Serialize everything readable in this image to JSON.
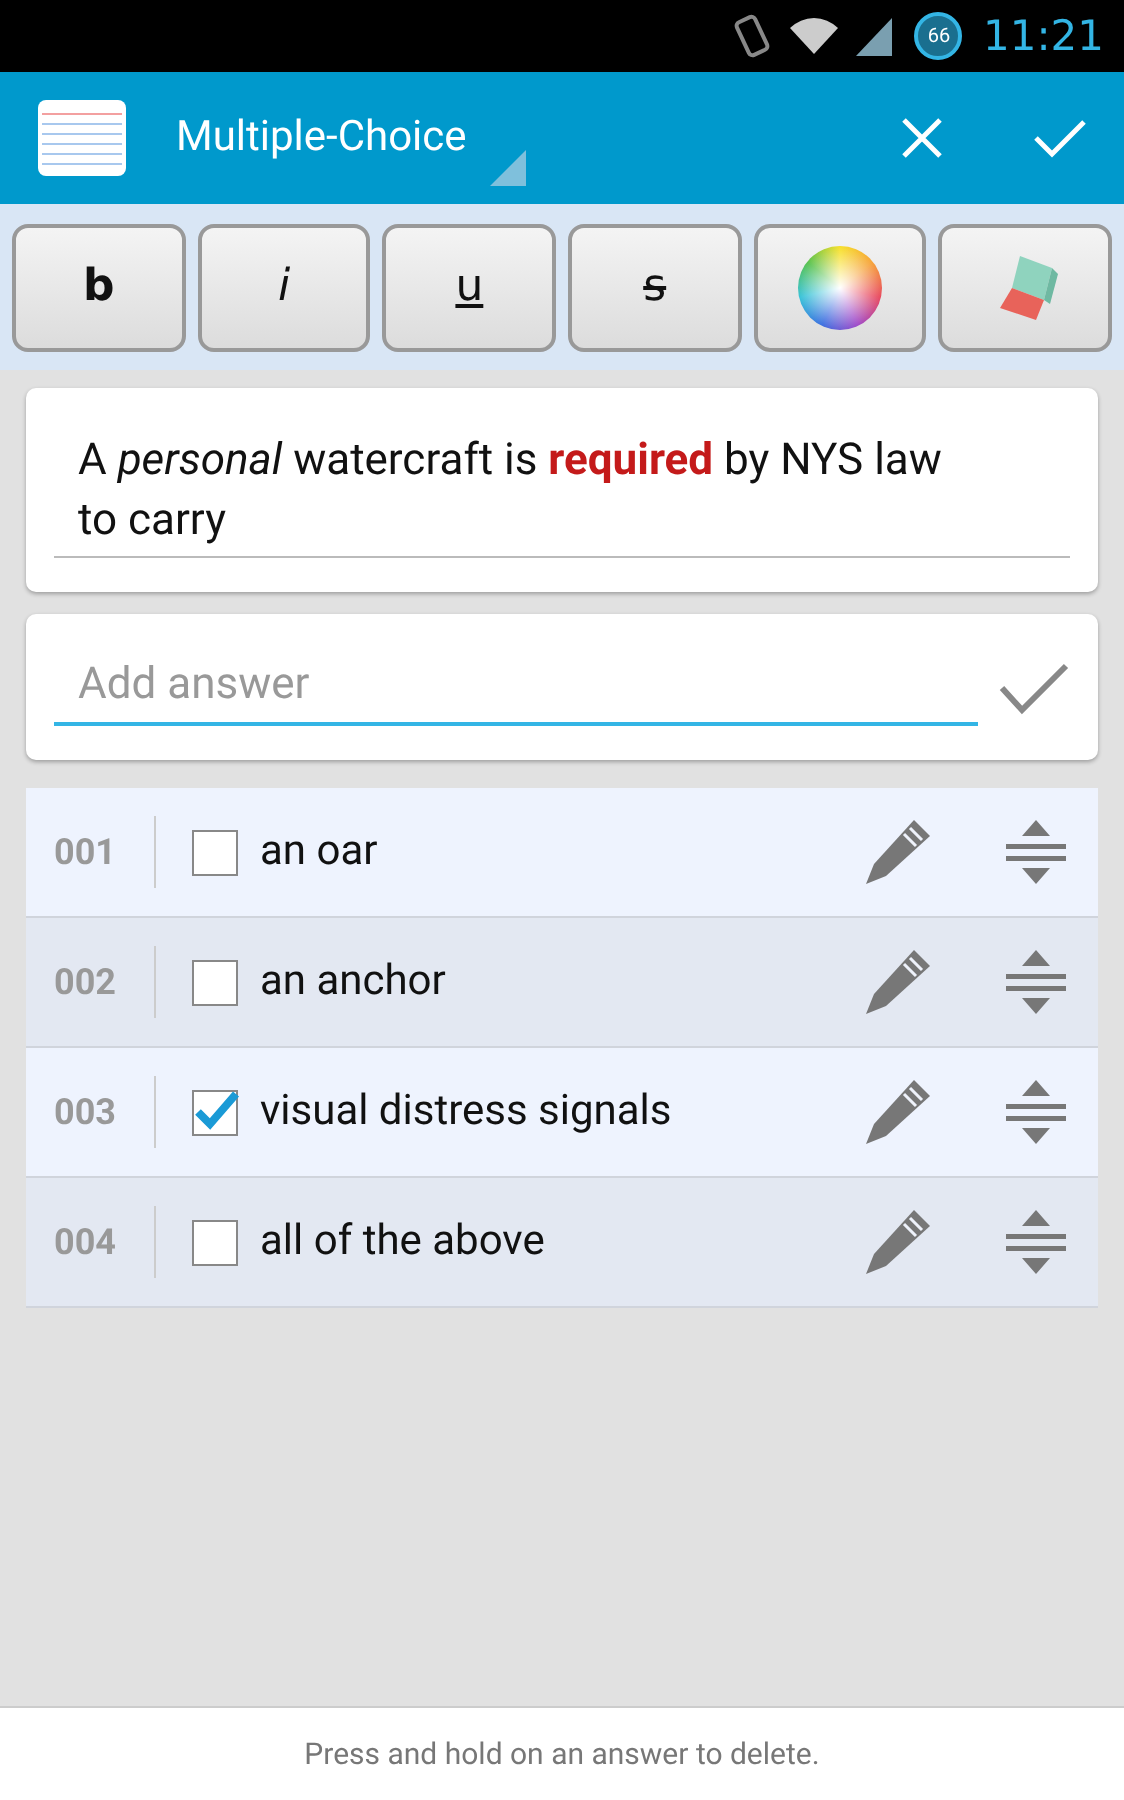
{
  "status_bar": {
    "battery": "66",
    "time": "11:21"
  },
  "action_bar": {
    "title": "Multiple-Choice"
  },
  "format_buttons": [
    {
      "kind": "bold",
      "label": "b"
    },
    {
      "kind": "italic",
      "label": "i"
    },
    {
      "kind": "underline",
      "label": "u"
    },
    {
      "kind": "strike",
      "label": "s"
    },
    {
      "kind": "color"
    },
    {
      "kind": "eraser"
    }
  ],
  "question": {
    "value": "A *personal* watercraft is **required** by NYS law to carry"
  },
  "answer_field": {
    "placeholder": "Add answer"
  },
  "answers": [
    {
      "number": "001",
      "text": "an oar",
      "checked": false
    },
    {
      "number": "002",
      "text": "an anchor",
      "checked": false
    },
    {
      "number": "003",
      "text": "visual distress signals",
      "checked": true
    },
    {
      "number": "004",
      "text": "all of the above",
      "checked": false
    }
  ],
  "footer": {
    "hint": "Press and hold on an answer to delete."
  }
}
